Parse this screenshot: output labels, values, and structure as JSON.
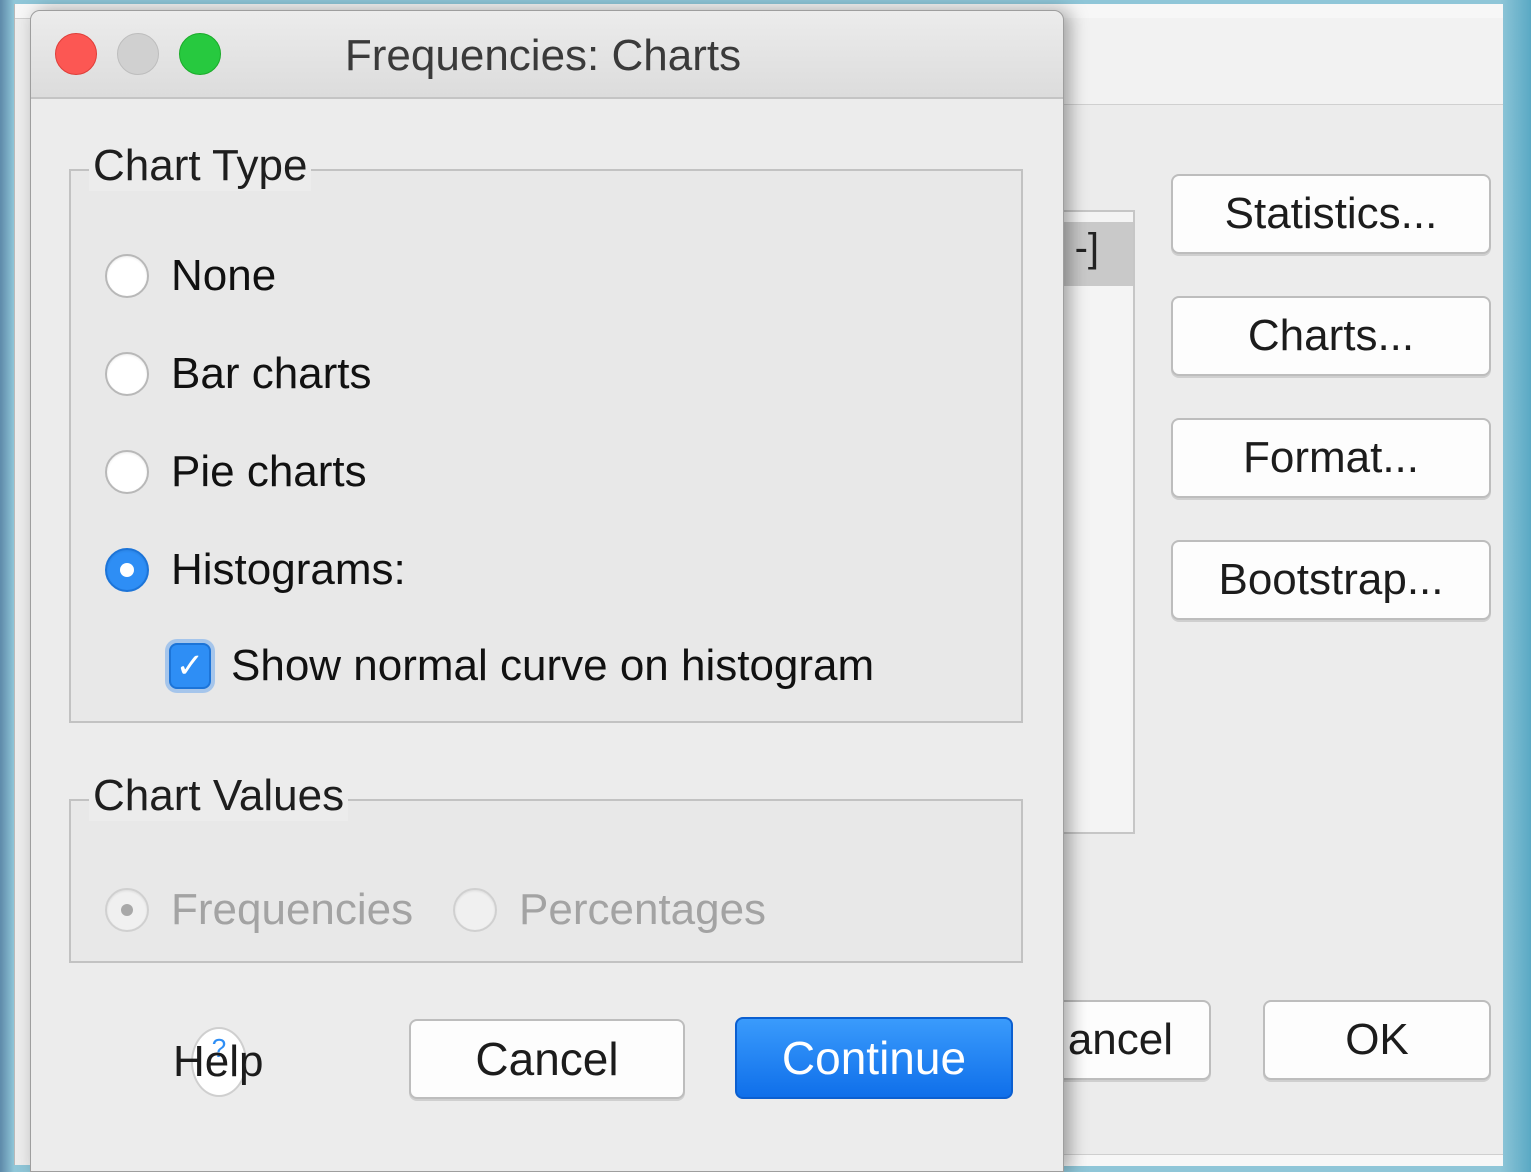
{
  "dialog": {
    "title": "Frequencies: Charts",
    "chart_type": {
      "legend": "Chart Type",
      "options": [
        {
          "label": "None",
          "selected": false
        },
        {
          "label": "Bar charts",
          "selected": false
        },
        {
          "label": "Pie charts",
          "selected": false
        },
        {
          "label": "Histograms:",
          "selected": true
        }
      ],
      "normal_curve": {
        "label": "Show normal curve on histogram",
        "checked": true
      }
    },
    "chart_values": {
      "legend": "Chart Values",
      "options": [
        {
          "label": "Frequencies",
          "selected": true,
          "enabled": false
        },
        {
          "label": "Percentages",
          "selected": false,
          "enabled": false
        }
      ]
    },
    "buttons": {
      "help": "Help",
      "cancel": "Cancel",
      "continue": "Continue"
    }
  },
  "background_window": {
    "list_fragment": "-]",
    "buttons": {
      "statistics": "Statistics...",
      "charts": "Charts...",
      "format": "Format...",
      "bootstrap": "Bootstrap...",
      "cancel_fragment": "ancel",
      "ok": "OK"
    }
  },
  "colors": {
    "accent": "#2e8ef5",
    "close": "#fc5753",
    "maximize": "#27c93f"
  }
}
